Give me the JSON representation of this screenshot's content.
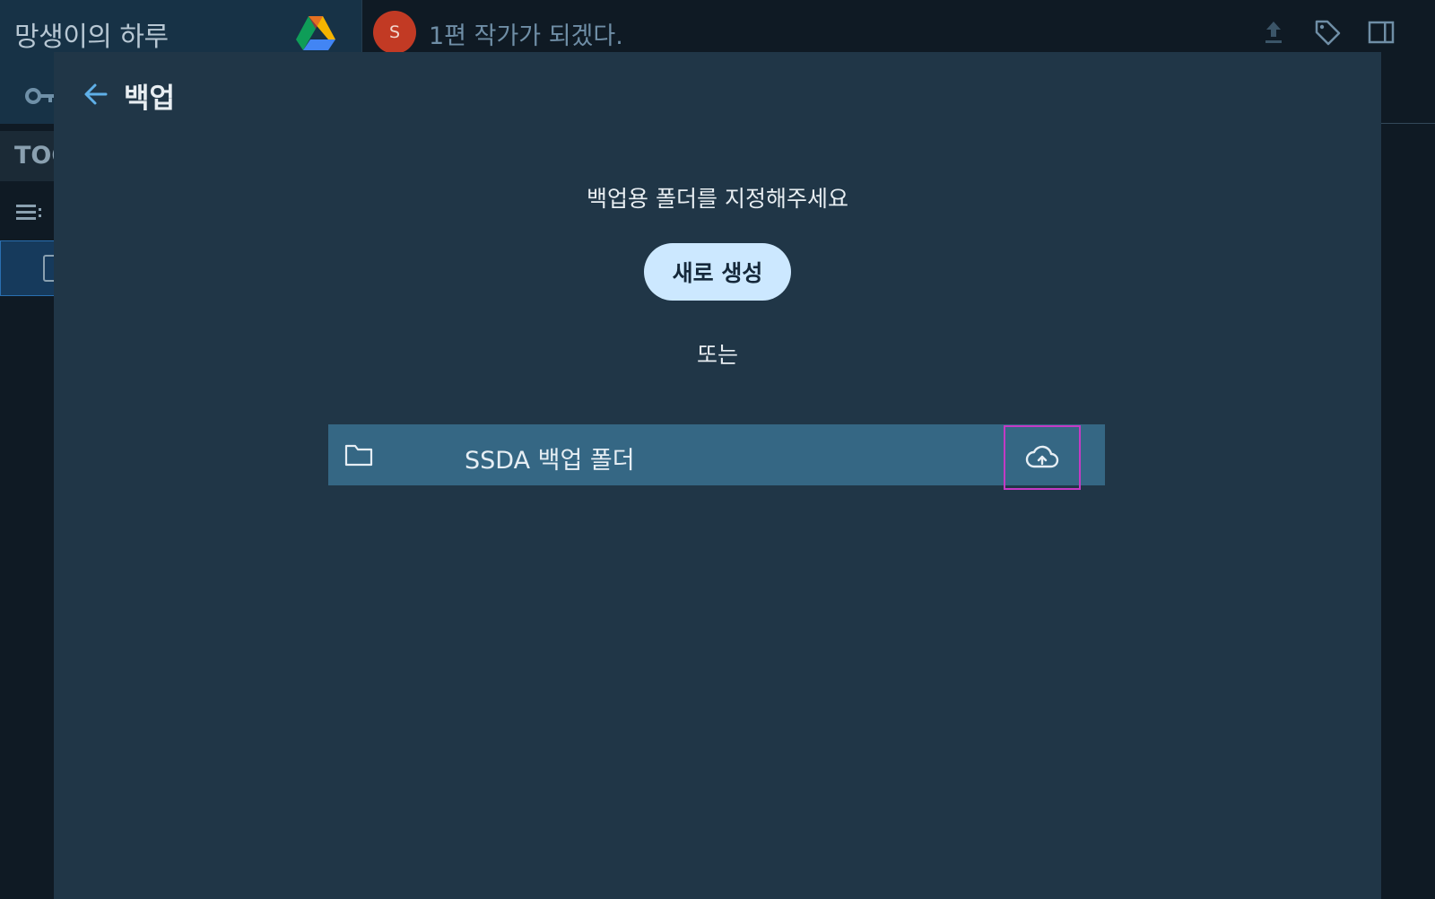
{
  "notebook": {
    "title": "망생이의 하루",
    "toc_label": "TOC"
  },
  "document": {
    "avatar_initial": "S",
    "title": "1편 작가가 되겠다."
  },
  "toolbar": {
    "icons": [
      "upload-icon",
      "tag-icon",
      "side-panel-icon"
    ]
  },
  "backup_dialog": {
    "title": "백업",
    "prompt": "백업용 폴더를 지정해주세요",
    "create_label": "새로 생성",
    "or_label": "또는",
    "folders": [
      {
        "name": "SSDA 백업 폴더",
        "icon": "folder-icon",
        "action_icon": "cloud-upload-icon"
      }
    ]
  },
  "colors": {
    "modal_bg": "#203647",
    "folder_row_bg": "#356784",
    "create_button_bg": "#cce8ff",
    "avatar_bg": "#c23a24",
    "highlight_border": "#c43ac4"
  }
}
